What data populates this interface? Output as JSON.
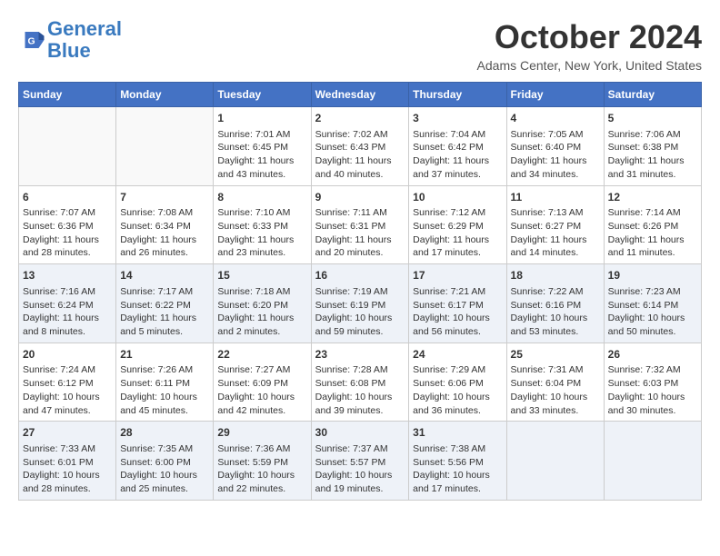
{
  "header": {
    "logo_line1": "General",
    "logo_line2": "Blue",
    "month_title": "October 2024",
    "location": "Adams Center, New York, United States"
  },
  "weekdays": [
    "Sunday",
    "Monday",
    "Tuesday",
    "Wednesday",
    "Thursday",
    "Friday",
    "Saturday"
  ],
  "weeks": [
    [
      {
        "day": "",
        "content": ""
      },
      {
        "day": "",
        "content": ""
      },
      {
        "day": "1",
        "content": "Sunrise: 7:01 AM\nSunset: 6:45 PM\nDaylight: 11 hours and 43 minutes."
      },
      {
        "day": "2",
        "content": "Sunrise: 7:02 AM\nSunset: 6:43 PM\nDaylight: 11 hours and 40 minutes."
      },
      {
        "day": "3",
        "content": "Sunrise: 7:04 AM\nSunset: 6:42 PM\nDaylight: 11 hours and 37 minutes."
      },
      {
        "day": "4",
        "content": "Sunrise: 7:05 AM\nSunset: 6:40 PM\nDaylight: 11 hours and 34 minutes."
      },
      {
        "day": "5",
        "content": "Sunrise: 7:06 AM\nSunset: 6:38 PM\nDaylight: 11 hours and 31 minutes."
      }
    ],
    [
      {
        "day": "6",
        "content": "Sunrise: 7:07 AM\nSunset: 6:36 PM\nDaylight: 11 hours and 28 minutes."
      },
      {
        "day": "7",
        "content": "Sunrise: 7:08 AM\nSunset: 6:34 PM\nDaylight: 11 hours and 26 minutes."
      },
      {
        "day": "8",
        "content": "Sunrise: 7:10 AM\nSunset: 6:33 PM\nDaylight: 11 hours and 23 minutes."
      },
      {
        "day": "9",
        "content": "Sunrise: 7:11 AM\nSunset: 6:31 PM\nDaylight: 11 hours and 20 minutes."
      },
      {
        "day": "10",
        "content": "Sunrise: 7:12 AM\nSunset: 6:29 PM\nDaylight: 11 hours and 17 minutes."
      },
      {
        "day": "11",
        "content": "Sunrise: 7:13 AM\nSunset: 6:27 PM\nDaylight: 11 hours and 14 minutes."
      },
      {
        "day": "12",
        "content": "Sunrise: 7:14 AM\nSunset: 6:26 PM\nDaylight: 11 hours and 11 minutes."
      }
    ],
    [
      {
        "day": "13",
        "content": "Sunrise: 7:16 AM\nSunset: 6:24 PM\nDaylight: 11 hours and 8 minutes."
      },
      {
        "day": "14",
        "content": "Sunrise: 7:17 AM\nSunset: 6:22 PM\nDaylight: 11 hours and 5 minutes."
      },
      {
        "day": "15",
        "content": "Sunrise: 7:18 AM\nSunset: 6:20 PM\nDaylight: 11 hours and 2 minutes."
      },
      {
        "day": "16",
        "content": "Sunrise: 7:19 AM\nSunset: 6:19 PM\nDaylight: 10 hours and 59 minutes."
      },
      {
        "day": "17",
        "content": "Sunrise: 7:21 AM\nSunset: 6:17 PM\nDaylight: 10 hours and 56 minutes."
      },
      {
        "day": "18",
        "content": "Sunrise: 7:22 AM\nSunset: 6:16 PM\nDaylight: 10 hours and 53 minutes."
      },
      {
        "day": "19",
        "content": "Sunrise: 7:23 AM\nSunset: 6:14 PM\nDaylight: 10 hours and 50 minutes."
      }
    ],
    [
      {
        "day": "20",
        "content": "Sunrise: 7:24 AM\nSunset: 6:12 PM\nDaylight: 10 hours and 47 minutes."
      },
      {
        "day": "21",
        "content": "Sunrise: 7:26 AM\nSunset: 6:11 PM\nDaylight: 10 hours and 45 minutes."
      },
      {
        "day": "22",
        "content": "Sunrise: 7:27 AM\nSunset: 6:09 PM\nDaylight: 10 hours and 42 minutes."
      },
      {
        "day": "23",
        "content": "Sunrise: 7:28 AM\nSunset: 6:08 PM\nDaylight: 10 hours and 39 minutes."
      },
      {
        "day": "24",
        "content": "Sunrise: 7:29 AM\nSunset: 6:06 PM\nDaylight: 10 hours and 36 minutes."
      },
      {
        "day": "25",
        "content": "Sunrise: 7:31 AM\nSunset: 6:04 PM\nDaylight: 10 hours and 33 minutes."
      },
      {
        "day": "26",
        "content": "Sunrise: 7:32 AM\nSunset: 6:03 PM\nDaylight: 10 hours and 30 minutes."
      }
    ],
    [
      {
        "day": "27",
        "content": "Sunrise: 7:33 AM\nSunset: 6:01 PM\nDaylight: 10 hours and 28 minutes."
      },
      {
        "day": "28",
        "content": "Sunrise: 7:35 AM\nSunset: 6:00 PM\nDaylight: 10 hours and 25 minutes."
      },
      {
        "day": "29",
        "content": "Sunrise: 7:36 AM\nSunset: 5:59 PM\nDaylight: 10 hours and 22 minutes."
      },
      {
        "day": "30",
        "content": "Sunrise: 7:37 AM\nSunset: 5:57 PM\nDaylight: 10 hours and 19 minutes."
      },
      {
        "day": "31",
        "content": "Sunrise: 7:38 AM\nSunset: 5:56 PM\nDaylight: 10 hours and 17 minutes."
      },
      {
        "day": "",
        "content": ""
      },
      {
        "day": "",
        "content": ""
      }
    ]
  ]
}
